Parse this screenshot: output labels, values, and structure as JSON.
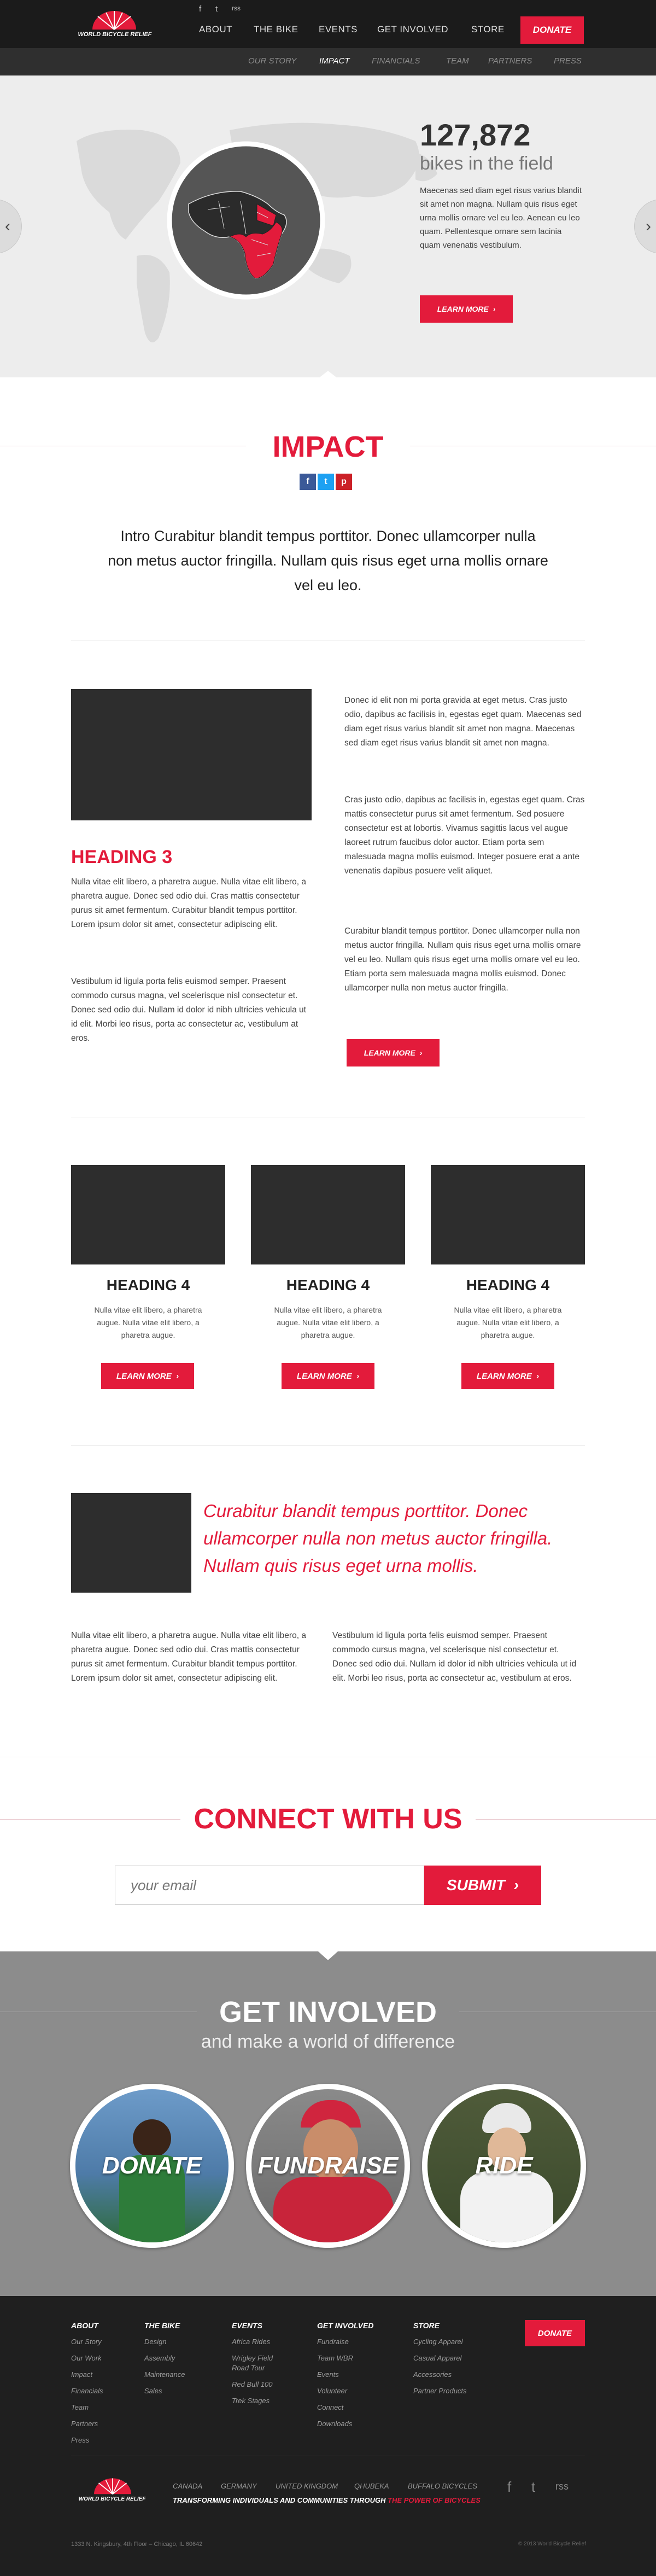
{
  "header": {
    "logo_text": "WORLD BICYCLE RELIEF",
    "social": [
      "f",
      "t",
      "rss"
    ],
    "nav": [
      "ABOUT",
      "THE BIKE",
      "EVENTS",
      "GET INVOLVED",
      "STORE"
    ],
    "donate": "DONATE",
    "subnav": [
      "OUR STORY",
      "IMPACT",
      "FINANCIALS",
      "TEAM",
      "PARTNERS",
      "PRESS"
    ],
    "subnav_active": "IMPACT"
  },
  "hero": {
    "stat": "127,872",
    "stat_label": "bikes in the field",
    "body": "Maecenas sed diam eget risus varius blandit sit amet non magna. Nullam quis risus eget urna mollis ornare vel eu leo. Aenean eu leo quam. Pellentesque ornare sem lacinia quam venenatis vestibulum.",
    "button": "LEARN MORE",
    "prev_icon": "chevron-left-icon",
    "next_icon": "chevron-right-icon"
  },
  "impact": {
    "title": "IMPACT",
    "share": [
      "f",
      "t",
      "p"
    ],
    "intro": "Intro Curabitur blandit tempus porttitor. Donec ullamcorper nulla non metus auctor fringilla. Nullam quis risus eget urna mollis ornare vel eu leo."
  },
  "section3": {
    "heading": "HEADING 3",
    "left_p1": "Nulla vitae elit libero, a pharetra augue. Nulla vitae elit libero, a pharetra augue. Donec sed odio dui. Cras mattis consectetur purus sit amet fermentum. Curabitur blandit tempus porttitor. Lorem ipsum dolor sit amet, consectetur adipiscing elit.",
    "left_p2": "Vestibulum id ligula porta felis euismod semper. Praesent commodo cursus magna, vel scelerisque nisl consectetur et. Donec sed odio dui. Nullam id dolor id nibh ultricies vehicula ut id elit. Morbi leo risus, porta ac consectetur ac, vestibulum at eros.",
    "right_p1": "Donec id elit non mi porta gravida at eget metus. Cras justo odio, dapibus ac facilisis in, egestas eget quam. Maecenas sed diam eget risus varius blandit sit amet non magna. Maecenas sed diam eget risus varius blandit sit amet non magna.",
    "right_p2": "Cras justo odio, dapibus ac facilisis in, egestas eget quam. Cras mattis consectetur purus sit amet fermentum. Sed posuere consectetur est at lobortis. Vivamus sagittis lacus vel augue laoreet rutrum faucibus dolor auctor. Etiam porta sem malesuada magna mollis euismod. Integer posuere erat a ante venenatis dapibus posuere velit aliquet.",
    "right_p3": "Curabitur blandit tempus porttitor. Donec ullamcorper nulla non metus auctor fringilla. Nullam quis risus eget urna mollis ornare vel eu leo. Nullam quis risus eget urna mollis ornare vel eu leo. Etiam porta sem malesuada magna mollis euismod. Donec ullamcorper nulla non metus auctor fringilla.",
    "button": "LEARN MORE"
  },
  "cards": [
    {
      "heading": "HEADING 4",
      "text": "Nulla vitae elit libero, a pharetra augue. Nulla vitae elit libero, a pharetra augue.",
      "button": "LEARN MORE"
    },
    {
      "heading": "HEADING 4",
      "text": "Nulla vitae elit libero, a pharetra augue. Nulla vitae elit libero, a pharetra augue.",
      "button": "LEARN MORE"
    },
    {
      "heading": "HEADING 4",
      "text": "Nulla vitae elit libero, a pharetra augue. Nulla vitae elit libero, a pharetra augue.",
      "button": "LEARN MORE"
    }
  ],
  "quote": {
    "text": "Curabitur blandit tempus porttitor. Donec ullamcorper nulla non metus auctor fringilla. Nullam quis risus eget urna mollis.",
    "left": "Nulla vitae elit libero, a pharetra augue. Nulla vitae elit libero, a pharetra augue. Donec sed odio dui. Cras mattis consectetur purus sit amet fermentum. Curabitur blandit tempus porttitor. Lorem ipsum dolor sit amet, consectetur adipiscing elit.",
    "right": "Vestibulum id ligula porta felis euismod semper. Praesent commodo cursus magna, vel scelerisque nisl consectetur et. Donec sed odio dui. Nullam id dolor id nibh ultricies vehicula ut id elit. Morbi leo risus, porta ac consectetur ac, vestibulum at eros."
  },
  "connect": {
    "title": "CONNECT WITH US",
    "placeholder": "your email",
    "submit": "SUBMIT"
  },
  "involved": {
    "title": "GET INVOLVED",
    "subtitle": "and make a world of difference",
    "circles": [
      "DONATE",
      "FUNDRAISE",
      "RIDE"
    ]
  },
  "footer": {
    "columns": [
      {
        "title": "ABOUT",
        "items": [
          "Our Story",
          "Our Work",
          "Impact",
          "Financials",
          "Team",
          "Partners",
          "Press"
        ]
      },
      {
        "title": "THE BIKE",
        "items": [
          "Design",
          "Assembly",
          "Maintenance",
          "Sales"
        ]
      },
      {
        "title": "EVENTS",
        "items": [
          "Africa Rides",
          "Wrigley Field",
          "Road Tour",
          "Red Bull 100",
          "Trek Stages"
        ]
      },
      {
        "title": "GET INVOLVED",
        "items": [
          "Fundraise",
          "Team WBR",
          "Events",
          "Volunteer",
          "Connect",
          "Downloads"
        ]
      },
      {
        "title": "STORE",
        "items": [
          "Cycling Apparel",
          "Casual Apparel",
          "Accessories",
          "Partner Products"
        ]
      }
    ],
    "donate": "DONATE",
    "countries": [
      "CANADA",
      "GERMANY",
      "UNITED KINGDOM",
      "QHUBEKA",
      "BUFFALO BICYCLES"
    ],
    "tagline_a": "TRANSFORMING INDIVIDUALS AND COMMUNITIES THROUGH ",
    "tagline_b": "THE POWER OF BICYCLES",
    "address": "1333 N. Kingsbury, 4th Floor – Chicago, IL 60642",
    "copyright": "© 2013 World Bicycle Relief",
    "social": [
      "f",
      "t",
      "rss"
    ]
  },
  "colors": {
    "accent": "#e31b3b",
    "dark": "#1b1b1b",
    "footer": "#1f1f1f"
  }
}
